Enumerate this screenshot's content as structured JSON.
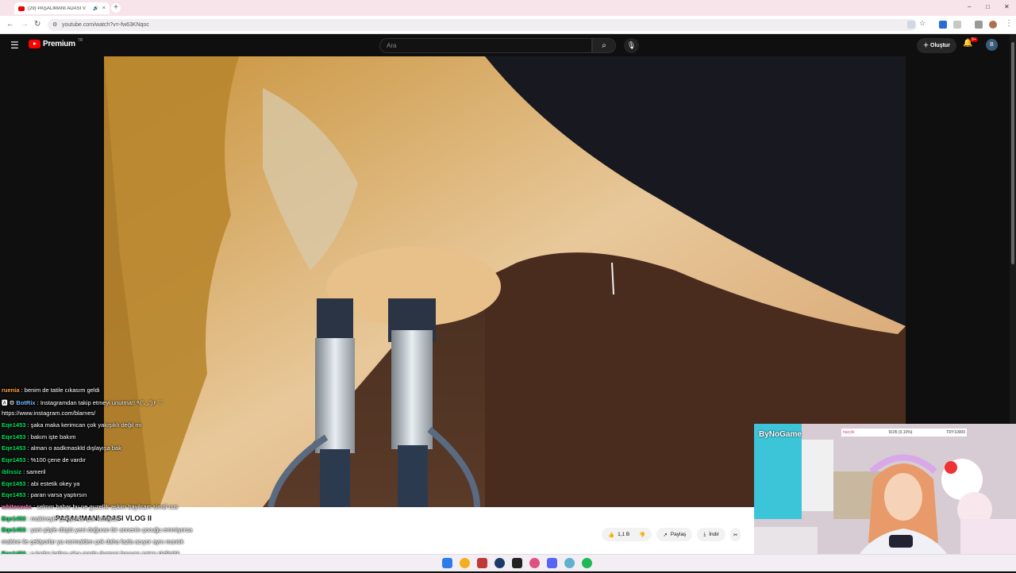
{
  "browser": {
    "tab_title": "(29) PAŞALIMANI ADASI V",
    "new_tab": "+",
    "tab_close": "×",
    "url": "youtube.com/watch?v=-fw63KNqoc",
    "win_min": "–",
    "win_max": "□",
    "win_close": "✕"
  },
  "youtube": {
    "brand": "Premium",
    "brand_sup": "TR",
    "search_placeholder": "Ara",
    "create_label": "Oluştur",
    "notif_count": "9+",
    "avatar_letter": "B",
    "video_title": "PAŞALIMANI ADASI VLOG II",
    "like_count": "1,1 B",
    "share_label": "Paylaş",
    "download_label": "İndir"
  },
  "chat": [
    {
      "user": "ruenia",
      "sep": " : ",
      "text": "benim de tatile cıkasım geldi",
      "color": "orange"
    },
    {
      "user": "BotRix",
      "sep": " : ",
      "text": "Instagramdan takip etmeyi unutma!! ٩(˘◡˘)۶ ♡",
      "color": "blue",
      "prefix": "🅰 ⚙ "
    },
    {
      "user": "",
      "sep": "",
      "text": "https://www.instagram.com/blarnes/",
      "color": ""
    },
    {
      "user": "Eqe1453",
      "sep": " : ",
      "text": "şaka maka kerimcan çok yakışıklı değil mi",
      "color": "green"
    },
    {
      "user": "Eqe1453",
      "sep": " : ",
      "text": "bakım işte bakım",
      "color": "green"
    },
    {
      "user": "Eqe1453",
      "sep": " : ",
      "text": "alman o asdkmaskld dışlayışa bak",
      "color": "green"
    },
    {
      "user": "Eqe1453",
      "sep": " : ",
      "text": "%100 çene de vardır",
      "color": "green"
    },
    {
      "user": "iblissiz",
      "sep": " : ",
      "text": "sameril",
      "color": "green"
    },
    {
      "user": "Eqe1453",
      "sep": " : ",
      "text": "abi estetik okey ya",
      "color": "green"
    },
    {
      "user": "Eqe1453",
      "sep": " : ",
      "text": "paran varsa yaptırsın",
      "color": "green"
    },
    {
      "user": "whitesw4n",
      "sep": " : ",
      "text": "selmm bahar bu ne guzellik askim bayilcam simdi cus",
      "color": "pink"
    },
    {
      "user": "Eqe1453",
      "sep": " : ",
      "text": "makineyle çekiyorlar çok kötüydü",
      "color": "green"
    },
    {
      "user": "Eqe1453",
      "sep": " : ",
      "text": "yani şöyle düştü yeni doğuran bir annenin çocuğu emmiyorsa",
      "color": "green"
    },
    {
      "user": "",
      "sep": "",
      "text": "makine ile çekiyorlar ya normalden çok daha fazla acıyor aynı mantık",
      "color": ""
    },
    {
      "user": "Eqe1453",
      "sep": " : ",
      "text": "o kadar kafası olsa orada durmaz hayvan zaten skdlmbk",
      "color": "green"
    },
    {
      "user": "Flo2638",
      "sep": " : ",
      "text": "slayy",
      "color": "green"
    }
  ],
  "overlay": {
    "stream_brand": "ByNoGame",
    "goal_label": "harçlık",
    "goal_progress": "9105 (0.10%)",
    "goal_target": "TRY10000"
  },
  "colors": {
    "yt_red": "#ff0000",
    "chat_green": "#00e05a",
    "header_bg": "#0f0f0f"
  }
}
